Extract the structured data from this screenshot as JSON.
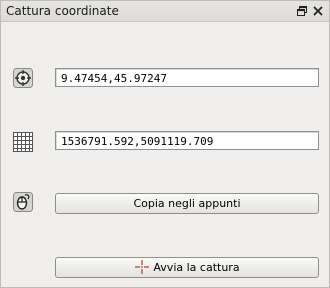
{
  "panel": {
    "title": "Cattura coordinate",
    "float_icon": "float-window-icon",
    "close_icon": "close-icon"
  },
  "rows": {
    "geographic": {
      "icon": "crosshair-globe-icon",
      "value": "9.47454,45.97247"
    },
    "projected": {
      "icon": "grid-icon",
      "value": "1536791.592,5091119.709"
    },
    "clipboard": {
      "icon": "clipboard-mouse-icon",
      "button_label": "Copia negli appunti"
    },
    "capture": {
      "icon": "crosshair-cursor-icon",
      "button_label": "Avvia la cattura"
    }
  }
}
